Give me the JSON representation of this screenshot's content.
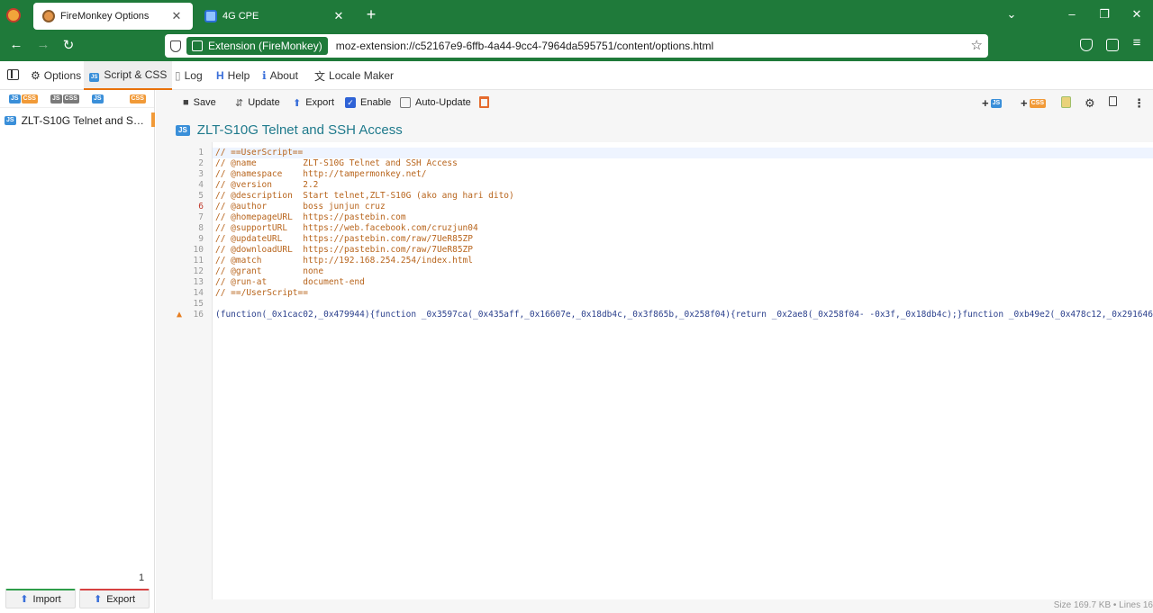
{
  "browser": {
    "tabs": [
      {
        "title": "FireMonkey Options",
        "active": true
      },
      {
        "title": "4G CPE",
        "active": false
      }
    ],
    "urlbar": {
      "identity_label": "Extension (FireMonkey)",
      "url": "moz-extension://c52167e9-6ffb-4a44-9cc4-7964da595751/content/options.html"
    },
    "theme_color": "#1f7a3a"
  },
  "topnav": {
    "items": [
      {
        "label": "Options",
        "icon": "gear-icon"
      },
      {
        "label": "Script & CSS",
        "icon": "js-icon",
        "active": true
      },
      {
        "label": "Log",
        "icon": "document-icon"
      },
      {
        "label": "Help",
        "icon": "help-icon"
      },
      {
        "label": "About",
        "icon": "info-icon"
      },
      {
        "label": "Locale Maker",
        "icon": "translate-icon"
      }
    ]
  },
  "sidebar": {
    "filters": [
      "JS",
      "CSS",
      "JS",
      "CSS",
      "JS",
      "CSS"
    ],
    "scripts": [
      {
        "type": "JS",
        "name": "ZLT-S10G Telnet and SSH Access"
      }
    ],
    "count": "1",
    "import_label": "Import",
    "export_label": "Export"
  },
  "toolbar": {
    "save_label": "Save",
    "update_label": "Update",
    "export_label": "Export",
    "enable_label": "Enable",
    "enable_checked": true,
    "auto_update_label": "Auto-Update",
    "auto_update_checked": false
  },
  "editor": {
    "type_badge": "JS",
    "title": "ZLT-S10G Telnet and SSH Access",
    "lines": [
      {
        "n": "1",
        "text": "// ==UserScript=="
      },
      {
        "n": "2",
        "text": "// @name         ZLT-S10G Telnet and SSH Access"
      },
      {
        "n": "3",
        "text": "// @namespace    http://tampermonkey.net/"
      },
      {
        "n": "4",
        "text": "// @version      2.2"
      },
      {
        "n": "5",
        "text": "// @description  Start telnet,ZLT-S10G (ako ang hari dito)"
      },
      {
        "n": "6",
        "text": "// @author       boss junjun cruz"
      },
      {
        "n": "7",
        "text": "// @homepageURL  https://pastebin.com"
      },
      {
        "n": "8",
        "text": "// @supportURL   https://web.facebook.com/cruzjun04"
      },
      {
        "n": "9",
        "text": "// @updateURL    https://pastebin.com/raw/7UeR85ZP"
      },
      {
        "n": "10",
        "text": "// @downloadURL  https://pastebin.com/raw/7UeR85ZP"
      },
      {
        "n": "11",
        "text": "// @match        http://192.168.254.254/index.html"
      },
      {
        "n": "12",
        "text": "// @grant        none"
      },
      {
        "n": "13",
        "text": "// @run-at       document-end"
      },
      {
        "n": "14",
        "text": "// ==/UserScript=="
      },
      {
        "n": "15",
        "text": ""
      },
      {
        "n": "16",
        "text": "(function(_0x1cac02,_0x479944){function _0x3597ca(_0x435aff,_0x16607e,_0x18db4c,_0x3f865b,_0x258f04){return _0x2ae8(_0x258f04- -0x3f,_0x18db4c);}function _0xb49e2(_0x478c12,_0x291646,_0"
      }
    ],
    "status": "Size 169.7 KB  •  Lines 16"
  }
}
